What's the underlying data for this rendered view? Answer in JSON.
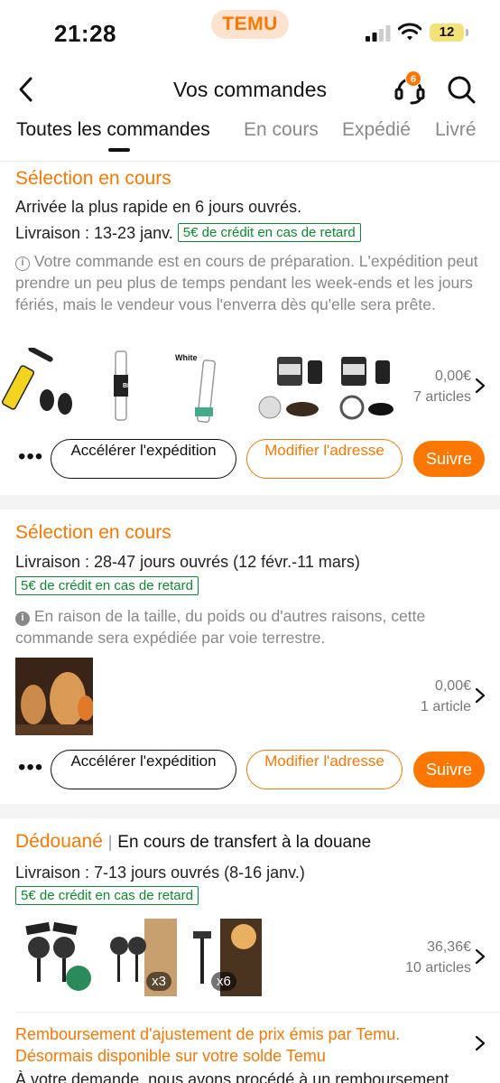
{
  "status_bar": {
    "time": "21:28",
    "app_pill": "TEMU",
    "battery": "12"
  },
  "header": {
    "title": "Vos commandes",
    "support_badge": "6"
  },
  "tabs": [
    {
      "label": "Toutes les commandes",
      "active": true
    },
    {
      "label": "En cours",
      "active": false
    },
    {
      "label": "Expédié",
      "active": false
    },
    {
      "label": "Livré",
      "active": false
    }
  ],
  "orders": [
    {
      "status": "Sélection en cours",
      "arrival": "Arrivée la plus rapide en 6 jours ouvrés.",
      "delivery": "Livraison : 13-23 janv.",
      "credit": "5€ de crédit en cas de retard",
      "note": "Votre commande est en cours de préparation. L'expédition peut prendre un peu plus de temps pendant les week-ends et les jours fériés, mais le vendeur vous l'enverra dès qu'elle sera prête.",
      "thumb_labels": [
        "BLACK",
        "White"
      ],
      "price": "0,00€",
      "count": "7 articles",
      "accelerate": "Accélérer l'expédition",
      "modify": "Modifier l'adresse",
      "follow": "Suivre"
    },
    {
      "status": "Sélection en cours",
      "delivery": "Livraison : 28-47 jours ouvrés (12 févr.-11 mars)",
      "credit": "5€ de crédit en cas de retard",
      "note": "En raison de la taille, du poids ou d'autres raisons, cette commande sera expédiée par voie terrestre.",
      "price": "0,00€",
      "count": "1 article",
      "accelerate": "Accélérer l'expédition",
      "modify": "Modifier l'adresse",
      "follow": "Suivre"
    },
    {
      "status": "Dédouané",
      "status_extra": "En cours de transfert à la douane",
      "delivery": "Livraison : 7-13 jours ouvrés (8-16 janv.)",
      "credit": "5€ de crédit en cas de retard",
      "thumb_qty": [
        "x3",
        "x6"
      ],
      "price": "36,36€",
      "count": "10 articles",
      "refund_title": "Remboursement d'ajustement de prix émis par Temu. Désormais disponible sur votre solde Temu",
      "refund_body": "À votre demande, nous avons procédé à un remboursement"
    }
  ],
  "colors": {
    "accent": "#fb7701",
    "credit_green": "#0a8c2e"
  }
}
